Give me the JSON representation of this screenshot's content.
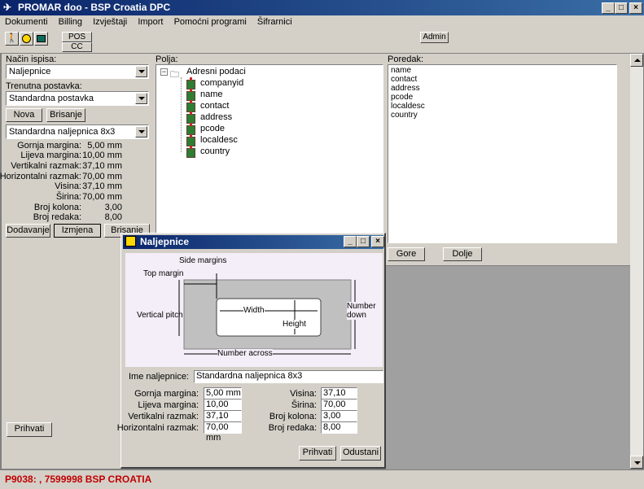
{
  "window": {
    "title": "PROMAR doo - BSP Croatia DPC"
  },
  "menu": [
    "Dokumenti",
    "Billing",
    "Izvještaji",
    "Import",
    "Pomoćni programi",
    "Šifrarnici"
  ],
  "toolbar": {
    "pos_label": "POS",
    "cc_label": "CC",
    "admin_label": "Admin"
  },
  "left": {
    "nacin_label": "Način ispisa:",
    "nacin_value": "Naljepnice",
    "postavka_label": "Trenutna postavka:",
    "postavka_value": "Standardna postavka",
    "nova_label": "Nova",
    "brisanje_label": "Brisanje",
    "format_value": "Standardna naljepnica 8x3",
    "props": [
      {
        "label": "Gornja margina:",
        "value": "5,00 mm"
      },
      {
        "label": "Lijeva margina:",
        "value": "10,00 mm"
      },
      {
        "label": "Vertikalni razmak:",
        "value": "37,10 mm"
      },
      {
        "label": "Horizontalni razmak:",
        "value": "70,00 mm"
      },
      {
        "label": "Visina:",
        "value": "37,10 mm"
      },
      {
        "label": "Širina:",
        "value": "70,00 mm"
      },
      {
        "label": "Broj kolona:",
        "value": "3,00"
      },
      {
        "label": "Broj redaka:",
        "value": "8,00"
      }
    ],
    "dodavanje_label": "Dodavanje",
    "izmjena_label": "Izmjena",
    "brisanje2_label": "Brisanje",
    "prihvati_label": "Prihvati"
  },
  "polja": {
    "label": "Polja:",
    "root": "Adresni podaci",
    "items": [
      "companyid",
      "name",
      "contact",
      "address",
      "pcode",
      "localdesc",
      "country"
    ]
  },
  "poredak": {
    "label": "Poredak:",
    "items": [
      "name",
      "contact",
      "address",
      "pcode",
      "localdesc",
      "country"
    ],
    "gore_label": "Gore",
    "dolje_label": "Dolje"
  },
  "dialog": {
    "title": "Naljepnice",
    "diagram": {
      "side_margins": "Side margins",
      "top_margin": "Top margin",
      "vertical_pitch": "Vertical pitch",
      "width": "Width",
      "height": "Height",
      "number_down": "Number down",
      "number_across": "Number across"
    },
    "ime_label": "Ime naljepnice:",
    "ime_value": "Standardna naljepnica 8x3",
    "left_fields": [
      {
        "label": "Gornja margina:",
        "value": "5,00 mm"
      },
      {
        "label": "Lijeva margina:",
        "value": "10,00 mm"
      },
      {
        "label": "Vertikalni razmak:",
        "value": "37,10 mm"
      },
      {
        "label": "Horizontalni razmak:",
        "value": "70,00 mm"
      }
    ],
    "right_fields": [
      {
        "label": "Visina:",
        "value": "37,10 mm"
      },
      {
        "label": "Širina:",
        "value": "70,00 mm"
      },
      {
        "label": "Broj kolona:",
        "value": "3,00"
      },
      {
        "label": "Broj redaka:",
        "value": "8,00"
      }
    ],
    "prihvati_label": "Prihvati",
    "odustani_label": "Odustani"
  },
  "status": {
    "text": "P9038: , 7599998 BSP CROATIA",
    "color": "#c00000"
  }
}
